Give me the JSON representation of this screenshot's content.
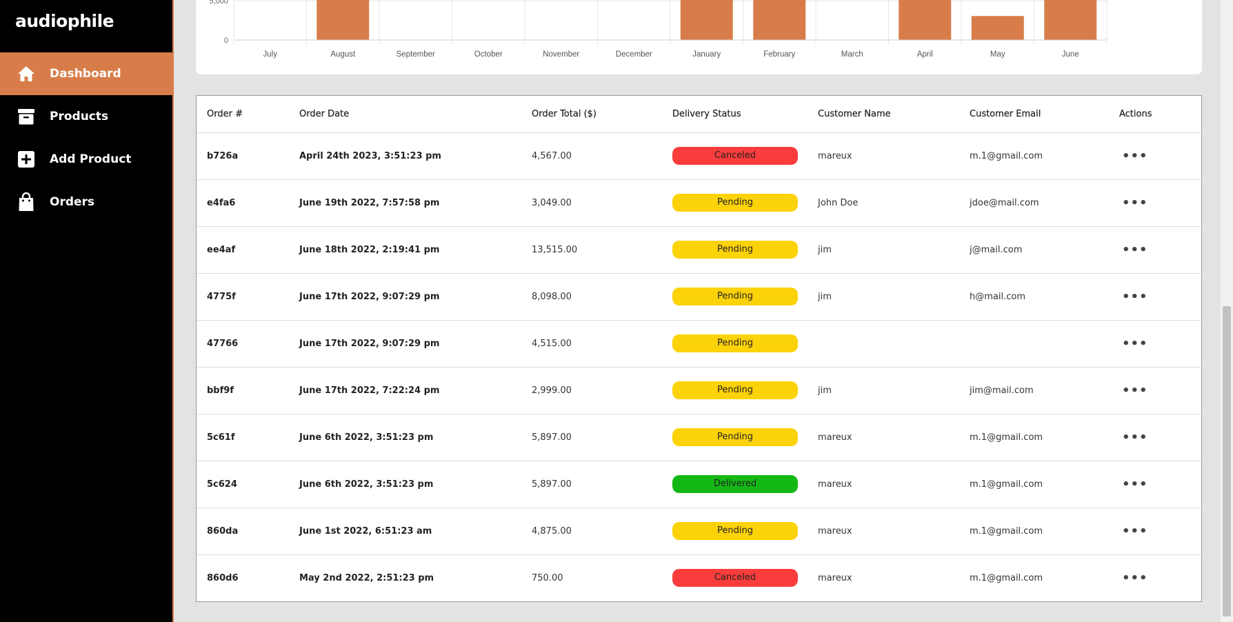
{
  "app": {
    "logo": "audiophile"
  },
  "sidebar": {
    "items": [
      {
        "label": "Dashboard",
        "icon": "home-icon",
        "active": true
      },
      {
        "label": "Products",
        "icon": "archive-box-icon",
        "active": false
      },
      {
        "label": "Add Product",
        "icon": "plus-square-icon",
        "active": false
      },
      {
        "label": "Orders",
        "icon": "shopping-bag-icon",
        "active": false
      }
    ]
  },
  "colors": {
    "accent": "#d87d4a",
    "pending": "#fcd209",
    "canceled": "#fa3c3c",
    "delivered": "#14b814"
  },
  "chart_data": {
    "type": "bar",
    "categories": [
      "July",
      "August",
      "September",
      "October",
      "November",
      "December",
      "January",
      "February",
      "March",
      "April",
      "May",
      "June"
    ],
    "values": [
      0,
      6500,
      0,
      0,
      0,
      0,
      6500,
      6500,
      0,
      6500,
      3049,
      6500
    ],
    "yticks": [
      "5,000",
      "0"
    ],
    "ylim": [
      0,
      5000
    ],
    "grid": true
  },
  "table": {
    "headers": [
      "Order #",
      "Order Date",
      "Order Total ($)",
      "Delivery Status",
      "Customer Name",
      "Customer Email",
      "Actions"
    ],
    "rows": [
      {
        "id": "b726a",
        "date": "April 24th 2023, 3:51:23 pm",
        "total": "4,567.00",
        "status": "Canceled",
        "status_class": "canceled",
        "name": "mareux",
        "email": "m.1@gmail.com",
        "actions": "•••"
      },
      {
        "id": "e4fa6",
        "date": "June 19th 2022, 7:57:58 pm",
        "total": "3,049.00",
        "status": "Pending",
        "status_class": "pending",
        "name": "John Doe",
        "email": "jdoe@mail.com",
        "actions": "•••"
      },
      {
        "id": "ee4af",
        "date": "June 18th 2022, 2:19:41 pm",
        "total": "13,515.00",
        "status": "Pending",
        "status_class": "pending",
        "name": "jim",
        "email": "j@mail.com",
        "actions": "•••"
      },
      {
        "id": "4775f",
        "date": "June 17th 2022, 9:07:29 pm",
        "total": "8,098.00",
        "status": "Pending",
        "status_class": "pending",
        "name": "jim",
        "email": "h@mail.com",
        "actions": "•••"
      },
      {
        "id": "47766",
        "date": "June 17th 2022, 9:07:29 pm",
        "total": "4,515.00",
        "status": "Pending",
        "status_class": "pending",
        "name": "",
        "email": "",
        "actions": "•••"
      },
      {
        "id": "bbf9f",
        "date": "June 17th 2022, 7:22:24 pm",
        "total": "2,999.00",
        "status": "Pending",
        "status_class": "pending",
        "name": "jim",
        "email": "jim@mail.com",
        "actions": "•••"
      },
      {
        "id": "5c61f",
        "date": "June 6th 2022, 3:51:23 pm",
        "total": "5,897.00",
        "status": "Pending",
        "status_class": "pending",
        "name": "mareux",
        "email": "m.1@gmail.com",
        "actions": "•••"
      },
      {
        "id": "5c624",
        "date": "June 6th 2022, 3:51:23 pm",
        "total": "5,897.00",
        "status": "Delivered",
        "status_class": "delivered",
        "name": "mareux",
        "email": "m.1@gmail.com",
        "actions": "•••"
      },
      {
        "id": "860da",
        "date": "June 1st 2022, 6:51:23 am",
        "total": "4,875.00",
        "status": "Pending",
        "status_class": "pending",
        "name": "mareux",
        "email": "m.1@gmail.com",
        "actions": "•••"
      },
      {
        "id": "860d6",
        "date": "May 2nd 2022, 2:51:23 pm",
        "total": "750.00",
        "status": "Canceled",
        "status_class": "canceled",
        "name": "mareux",
        "email": "m.1@gmail.com",
        "actions": "•••"
      }
    ]
  }
}
